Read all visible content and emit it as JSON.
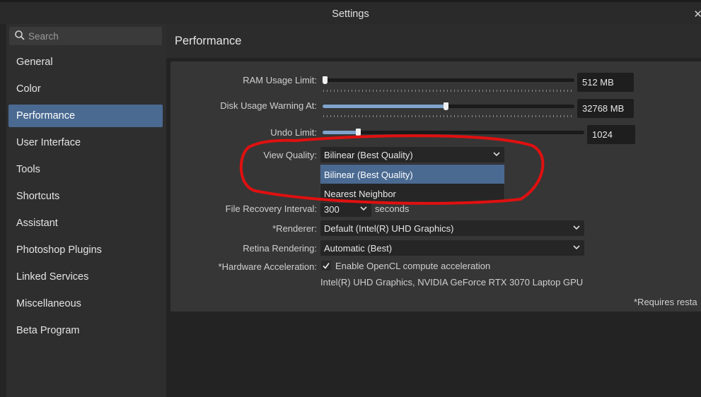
{
  "window": {
    "title": "Settings"
  },
  "search": {
    "placeholder": "Search"
  },
  "sidebar": {
    "items": [
      {
        "label": "General"
      },
      {
        "label": "Color"
      },
      {
        "label": "Performance"
      },
      {
        "label": "User Interface"
      },
      {
        "label": "Tools"
      },
      {
        "label": "Shortcuts"
      },
      {
        "label": "Assistant"
      },
      {
        "label": "Photoshop Plugins"
      },
      {
        "label": "Linked Services"
      },
      {
        "label": "Miscellaneous"
      },
      {
        "label": "Beta Program"
      }
    ],
    "active_index": 2
  },
  "page": {
    "title": "Performance"
  },
  "settings": {
    "ram": {
      "label": "RAM Usage Limit:",
      "value": "512 MB",
      "slider_fraction": 0.0
    },
    "disk": {
      "label": "Disk Usage Warning At:",
      "value": "32768 MB",
      "slider_fraction": 0.49
    },
    "undo": {
      "label": "Undo Limit:",
      "value": "1024",
      "slider_fraction": 0.13
    },
    "view_quality": {
      "label": "View Quality:",
      "selected": "Bilinear (Best Quality)",
      "options": [
        "Bilinear (Best Quality)",
        "Nearest Neighbor"
      ]
    },
    "file_recovery": {
      "label": "File Recovery Interval:",
      "value": "300",
      "unit": "seconds"
    },
    "renderer": {
      "label": "*Renderer:",
      "value": "Default (Intel(R) UHD Graphics)"
    },
    "retina": {
      "label": "Retina Rendering:",
      "value": "Automatic (Best)"
    },
    "hw_accel": {
      "label": "*Hardware Acceleration:",
      "checkbox_label": "Enable OpenCL compute acceleration",
      "checked": true,
      "gpu_info": "Intel(R) UHD Graphics, NVIDIA GeForce RTX 3070 Laptop GPU"
    },
    "restart_note": "*Requires resta"
  },
  "colors": {
    "accent": "#4a6a92",
    "slider_fill": "#7fa3cc",
    "annotation": "#e01010"
  }
}
